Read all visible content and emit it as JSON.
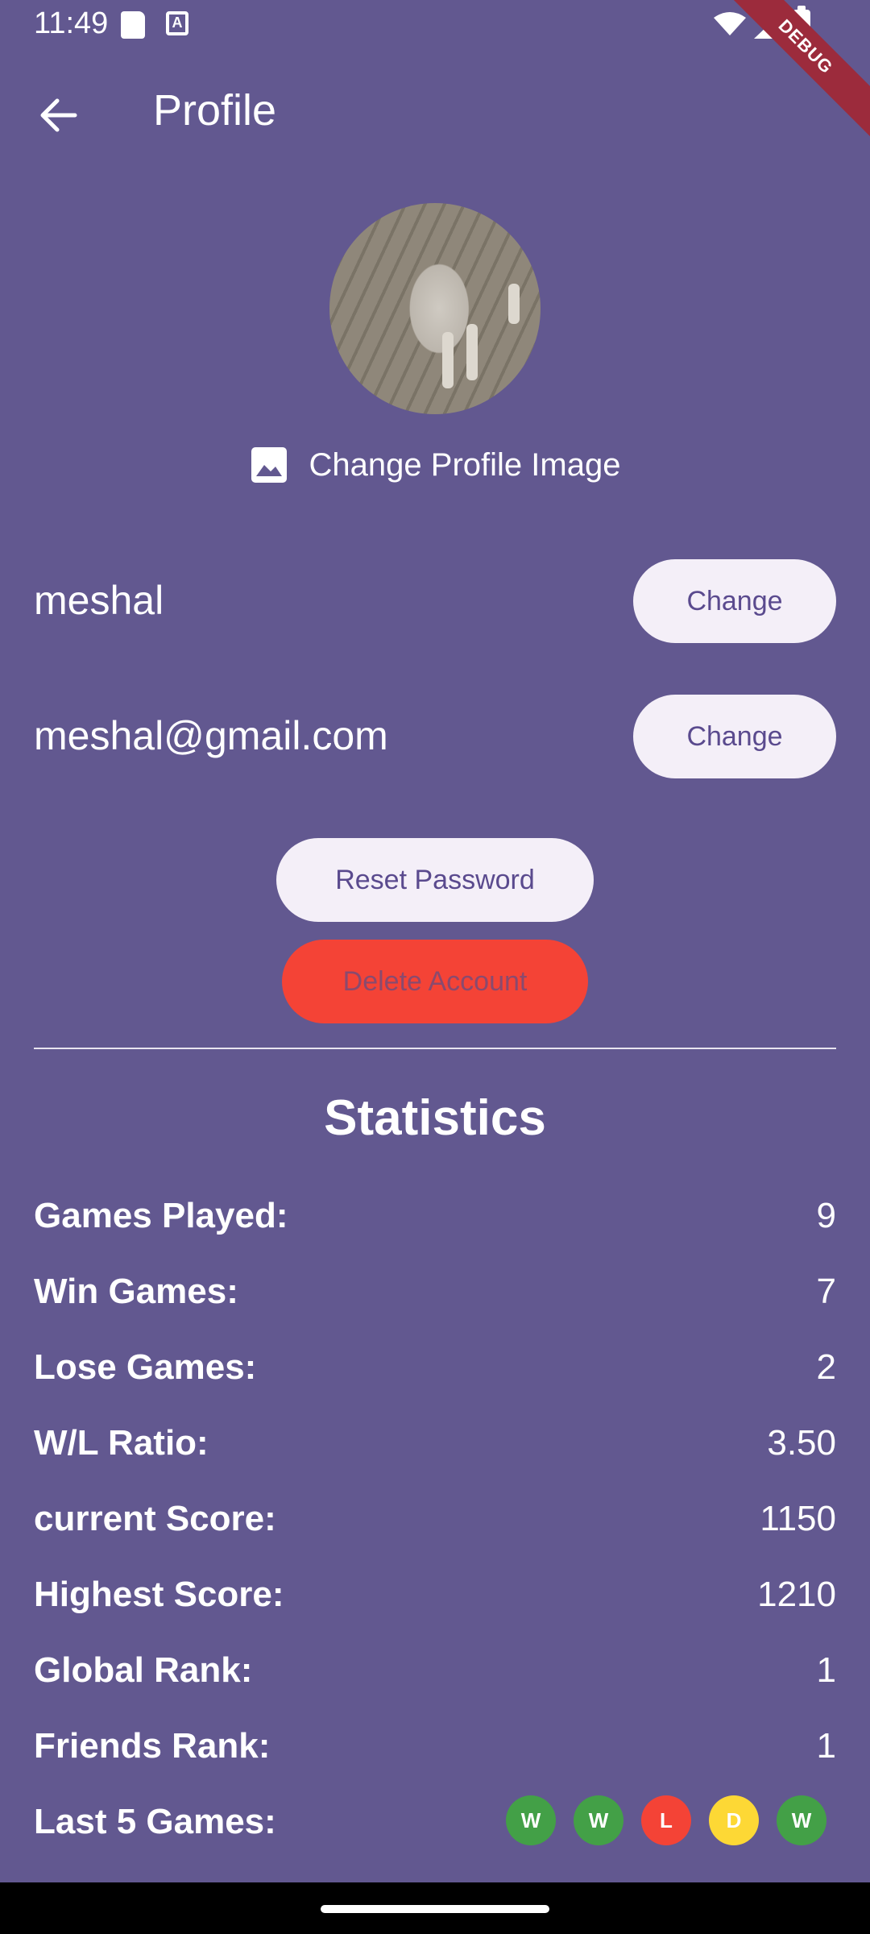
{
  "status_bar": {
    "time": "11:49",
    "a_badge": "A",
    "debug_label": "DEBUG"
  },
  "app_bar": {
    "title": "Profile"
  },
  "profile": {
    "change_image_label": "Change Profile Image",
    "username": "meshal",
    "email": "meshal@gmail.com",
    "change_label": "Change",
    "reset_password_label": "Reset Password",
    "delete_account_label": "Delete Account"
  },
  "statistics": {
    "title": "Statistics",
    "rows": [
      {
        "label": "Games Played:",
        "value": "9"
      },
      {
        "label": "Win Games:",
        "value": "7"
      },
      {
        "label": "Lose Games:",
        "value": "2"
      },
      {
        "label": "W/L Ratio:",
        "value": "3.50"
      },
      {
        "label": "current Score:",
        "value": "1150"
      },
      {
        "label": "Highest Score:",
        "value": "1210"
      },
      {
        "label": "Global Rank:",
        "value": "1"
      },
      {
        "label": "Friends Rank:",
        "value": "1"
      }
    ],
    "last_games_label": "Last 5 Games:",
    "last_games": [
      {
        "result": "W",
        "color": "#43a047"
      },
      {
        "result": "W",
        "color": "#43a047"
      },
      {
        "result": "L",
        "color": "#f44336"
      },
      {
        "result": "D",
        "color": "#fdd835"
      },
      {
        "result": "W",
        "color": "#43a047"
      }
    ]
  },
  "colors": {
    "background": "#625890",
    "button_bg": "#f4eff8",
    "button_text": "#5a4a8e",
    "delete_bg": "#f44336"
  }
}
